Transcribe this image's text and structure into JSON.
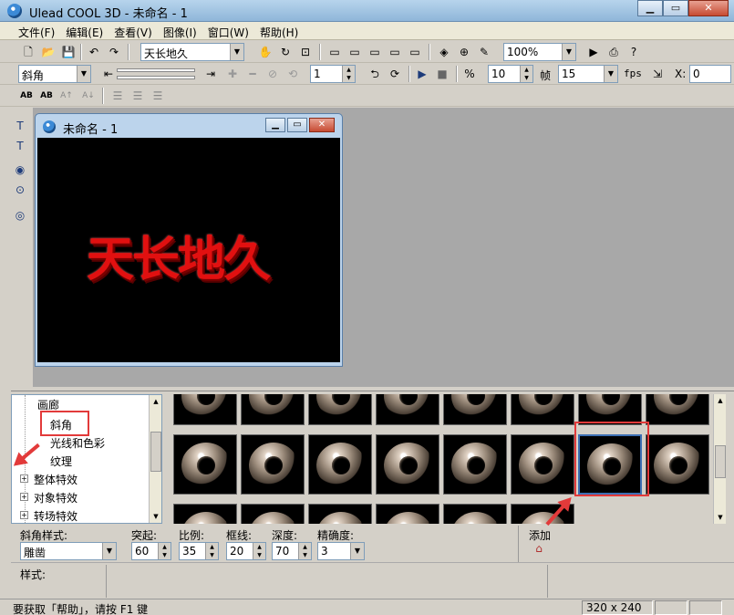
{
  "window": {
    "title": "Ulead COOL 3D - 未命名 - 1"
  },
  "menubar": [
    "文件(F)",
    "编辑(E)",
    "查看(V)",
    "图像(I)",
    "窗口(W)",
    "帮助(H)"
  ],
  "toolbar1": {
    "text_combo": "天长地久",
    "zoom_combo": "100%"
  },
  "toolbar2": {
    "effect_combo": "斜角",
    "frame_value": "1",
    "value2": "10",
    "frame_label": "帧",
    "fps_value": "15",
    "fps_label": "fps",
    "x_label": "X:",
    "x_value": "0"
  },
  "toolbar3": {
    "btn_ab1": "AB",
    "btn_ab2": "AB",
    "btn_ab3": "A↑",
    "btn_ab4": "A↓"
  },
  "child_window": {
    "title": "未命名 - 1",
    "text": "天长地久"
  },
  "tree": {
    "items": [
      {
        "label": "画廊",
        "level": 2
      },
      {
        "label": "斜角",
        "level": 2
      },
      {
        "label": "光线和色彩",
        "level": 2
      },
      {
        "label": "纹理",
        "level": 2
      },
      {
        "label": "整体特效",
        "level": 1
      },
      {
        "label": "对象特效",
        "level": 1
      },
      {
        "label": "转场特效",
        "level": 1
      }
    ]
  },
  "properties": {
    "bevel_style_label": "斜角样式:",
    "bevel_style_value": "雕凿",
    "protrude_label": "突起:",
    "protrude_value": "60",
    "scale_label": "比例:",
    "scale_value": "35",
    "border_label": "框线:",
    "border_value": "20",
    "depth_label": "深度:",
    "depth_value": "70",
    "precision_label": "精确度:",
    "precision_value": "3",
    "add_label": "添加",
    "style_label": "样式:"
  },
  "statusbar": {
    "help": "要获取「帮助」，请按 F1 键",
    "size": "320 x 240"
  }
}
